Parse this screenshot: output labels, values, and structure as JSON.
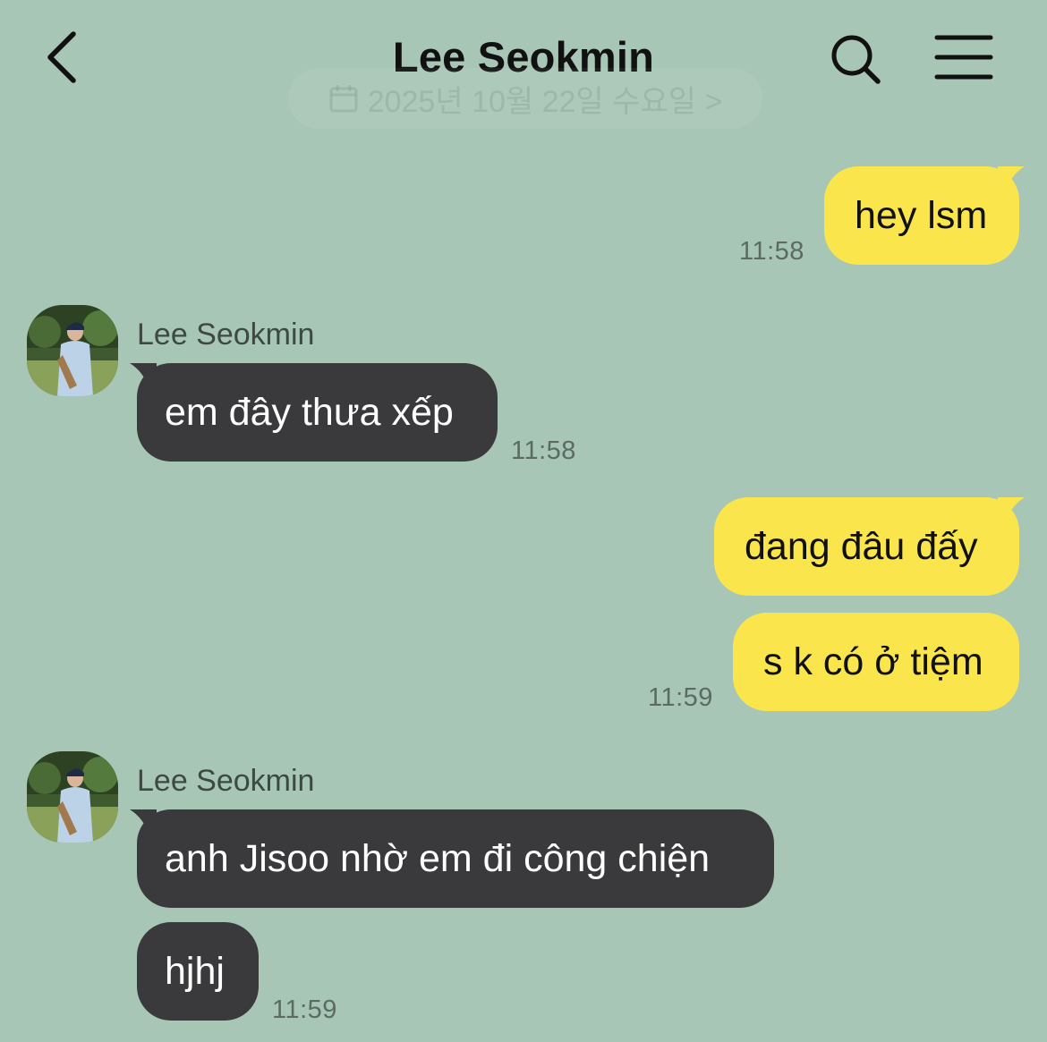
{
  "header": {
    "title": "Lee Seokmin",
    "back_icon": "chevron-left-icon",
    "search_icon": "search-icon",
    "menu_icon": "hamburger-menu-icon"
  },
  "date_separator": {
    "label": "2025년 10월 22일 수요일 >",
    "icon": "calendar-icon"
  },
  "colors": {
    "background": "#a8c6b6",
    "my_bubble": "#fae54c",
    "their_bubble": "#3a3a3c"
  },
  "messages": [
    {
      "from": "me",
      "text": "hey lsm",
      "time": "11:58"
    },
    {
      "from": "them",
      "sender": "Lee Seokmin",
      "text": "em đây thưa xếp",
      "time": "11:58"
    },
    {
      "from": "me",
      "text": "đang đâu đấy",
      "time": ""
    },
    {
      "from": "me",
      "text": "s k có ở tiệm",
      "time": "11:59"
    },
    {
      "from": "them",
      "sender": "Lee Seokmin",
      "text": "anh Jisoo nhờ em đi công chiện",
      "time": ""
    },
    {
      "from": "them",
      "text": "hjhj",
      "time": "11:59"
    }
  ]
}
